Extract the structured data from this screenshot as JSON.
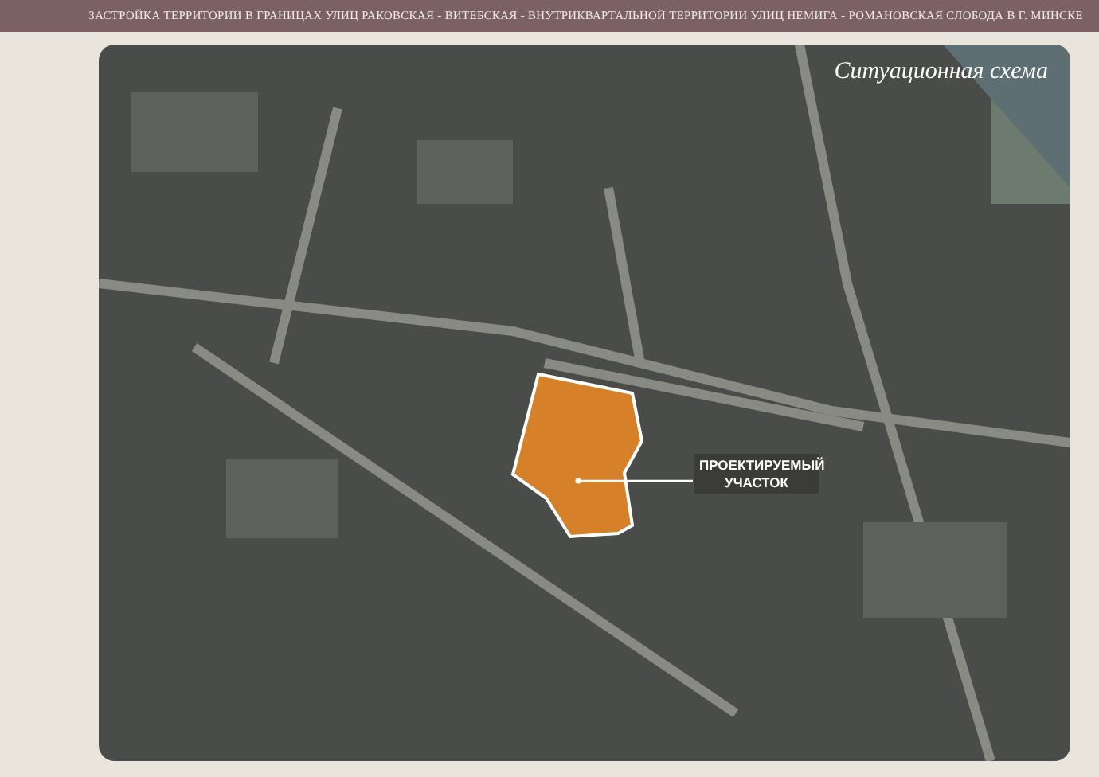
{
  "header": {
    "title": "ЗАСТРОЙКА ТЕРРИТОРИИ В ГРАНИЦАХ УЛИЦ РАКОВСКАЯ - ВИТЕБСКАЯ - ВНУТРИКВАРТАЛЬНОЙ ТЕРРИТОРИИ УЛИЦ НЕМИГА - РОМАНОВСКАЯ СЛОБОДА В Г. МИНСКЕ"
  },
  "map": {
    "title": "Ситуационная схема",
    "site_label": "ПРОЕКТИРУЕМЫЙ УЧАСТОК"
  }
}
